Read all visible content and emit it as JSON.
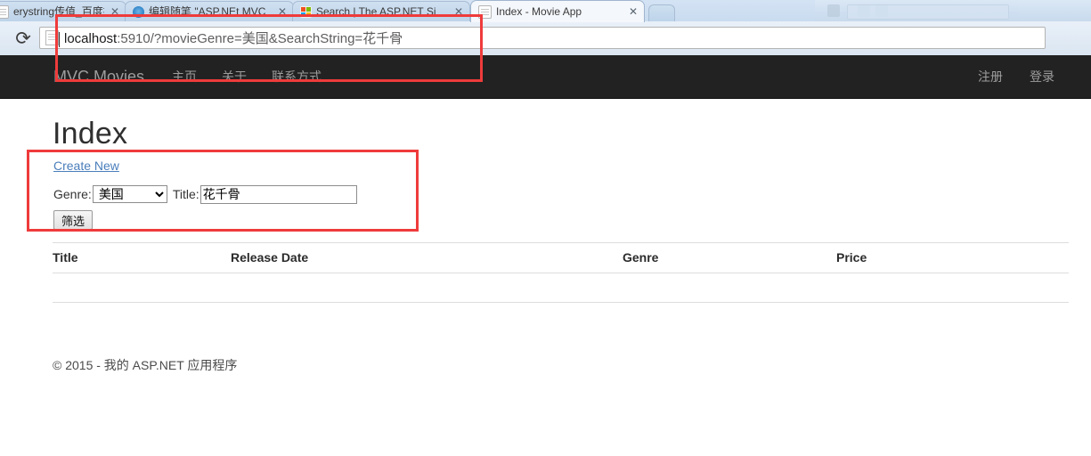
{
  "browser": {
    "tabs": [
      {
        "title": "erystring传值_百度搜",
        "favicon": "page-icon",
        "close": "✕",
        "active": false
      },
      {
        "title": "编辑随笔 \"ASP.NEt MVC",
        "favicon": "circle-icon",
        "close": "✕",
        "active": false
      },
      {
        "title": "Search | The ASP.NET Si",
        "favicon": "microsoft-icon",
        "close": "✕",
        "active": false
      },
      {
        "title": "Index - Movie App",
        "favicon": "page-icon",
        "close": "✕",
        "active": true
      }
    ],
    "reload_icon": "⟳",
    "url": {
      "host": "localhost",
      "rest": ":5910/?movieGenre=美国&SearchString=花千骨",
      "full": "localhost:5910/?movieGenre=美国&SearchString=花千骨"
    }
  },
  "navbar": {
    "brand": "MVC Movies",
    "links": [
      {
        "label": "主页"
      },
      {
        "label": "关于"
      },
      {
        "label": "联系方式"
      }
    ],
    "right_links": [
      {
        "label": "注册"
      },
      {
        "label": "登录"
      }
    ]
  },
  "main": {
    "page_title": "Index",
    "create_new_label": "Create New",
    "filter": {
      "genre_label": "Genre:",
      "genre_value": "美国",
      "genre_options": [
        "美国"
      ],
      "title_label": "Title:",
      "title_value": "花千骨",
      "title_placeholder": "",
      "submit_label": "筛选"
    },
    "table": {
      "columns": [
        "Title",
        "Release Date",
        "Genre",
        "Price"
      ],
      "rows": []
    }
  },
  "footer": {
    "text": "© 2015 - 我的 ASP.NET 应用程序"
  },
  "colors": {
    "navbar_bg": "#222222",
    "link": "#4a7ebb",
    "annotation": "#ef3b3b",
    "page_bg": "#ffffff"
  }
}
